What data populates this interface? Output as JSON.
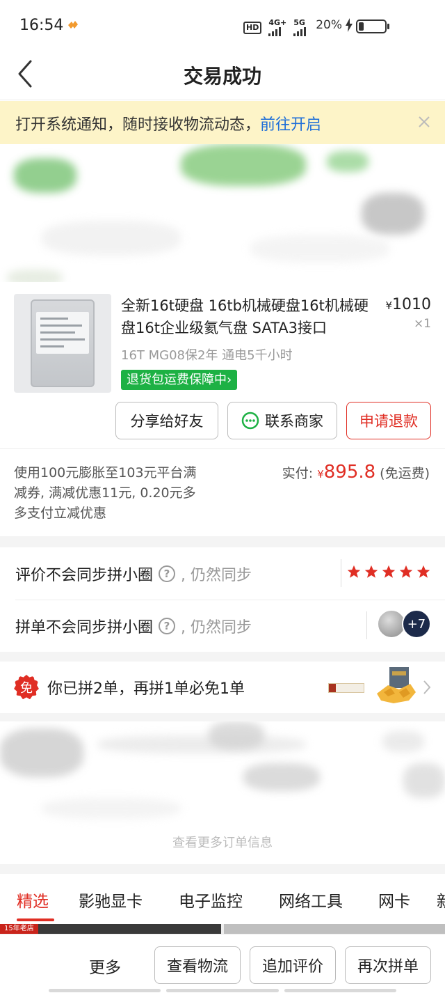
{
  "status_bar": {
    "time": "16:54",
    "hd_label": "HD",
    "net1": "4G+",
    "net2": "5G",
    "battery": "20%",
    "battery_level": 0.2
  },
  "nav": {
    "title": "交易成功",
    "back_icon": "chevron-left-icon"
  },
  "notice": {
    "text": "打开系统通知，随时接收物流动态，",
    "link": "前往开启",
    "close_icon": "close-icon"
  },
  "product": {
    "title": "全新16t硬盘 16tb机械硬盘16t机械硬盘16t企业级氦气盘 SATA3接口",
    "price_symbol": "¥",
    "price": "1010",
    "quantity": "×1",
    "spec": "16T MG08保2年 通电5千小时",
    "guarantee": "退货包运费保障中",
    "guarantee_arrow": "›"
  },
  "actions": {
    "share": "分享给好友",
    "contact": "联系商家",
    "refund": "申请退款"
  },
  "payment": {
    "description": "使用100元膨胀至103元平台满减券, 满减优惠11元, 0.20元多多支付立减优惠",
    "label": "实付:",
    "symbol": "¥",
    "amount": "895.8",
    "shipping": "(免运费)"
  },
  "social": {
    "review_label": "评价不会同步拼小圈",
    "review_suffix": ", 仍然同步",
    "review_stars": 5,
    "group_label": "拼单不会同步拼小圈",
    "group_suffix": ", 仍然同步",
    "help_icon": "?",
    "avatar_more": "+7"
  },
  "promo": {
    "badge": "免",
    "text": "你已拼2单，再拼1单必免1单"
  },
  "order_info": {
    "more_text": "查看更多订单信息"
  },
  "tabs": [
    {
      "label": "精选"
    },
    {
      "label": "影驰显卡"
    },
    {
      "label": "电子监控"
    },
    {
      "label": "网络工具"
    },
    {
      "label": "网卡"
    },
    {
      "label": "新"
    }
  ],
  "feed": {
    "tag": "15年老店"
  },
  "bottom_bar": {
    "more": "更多",
    "logistics": "查看物流",
    "add_review": "追加评价",
    "reorder": "再次拼单"
  },
  "colors": {
    "accent_red": "#e02e24",
    "guarantee_green": "#1db144",
    "notice_bg": "#fdf4c8",
    "link_blue": "#1f6fd8"
  }
}
